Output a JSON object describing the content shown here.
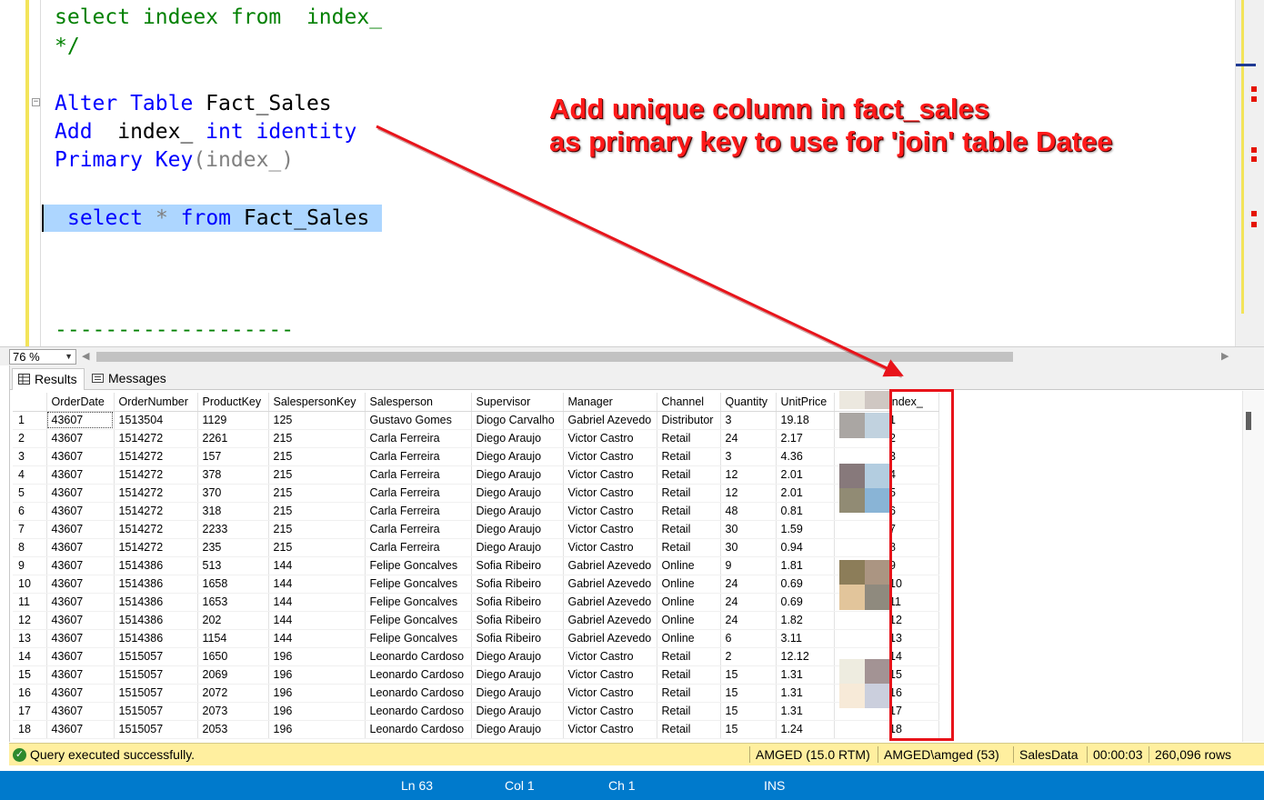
{
  "editor": {
    "line1": {
      "kw1": "select",
      "t1": " indeex ",
      "kw2": "from",
      "t2": "  index_"
    },
    "line2": "*/",
    "alter": {
      "kw": "Alter Table",
      "name": " Fact_Sales"
    },
    "add": {
      "kw": "Add",
      "mid": "  index_ ",
      "kw2": "int identity"
    },
    "pk": {
      "kw": "Primary Key",
      "rest": "(index_)"
    },
    "sel": {
      "kw": "select",
      "star": " * ",
      "kw2": "from",
      "name": " Fact_Sales "
    },
    "dashes": "-------------------"
  },
  "annotation": {
    "line1": "Add unique column in fact_sales",
    "line2": "as primary key to use for 'join' table Datee"
  },
  "zoom": {
    "value": "76 %"
  },
  "tabs": {
    "results": "Results",
    "messages": "Messages"
  },
  "grid": {
    "columns": [
      "OrderDate",
      "OrderNumber",
      "ProductKey",
      "SalespersonKey",
      "Salesperson",
      "Supervisor",
      "Manager",
      "Channel",
      "Quantity",
      "UnitPrice",
      "index_"
    ],
    "rows": [
      [
        "1",
        "43607",
        "1513504",
        "1129",
        "125",
        "Gustavo Gomes",
        "Diogo Carvalho",
        "Gabriel Azevedo",
        "Distributor",
        "3",
        "19.18",
        "1"
      ],
      [
        "2",
        "43607",
        "1514272",
        "2261",
        "215",
        "Carla Ferreira",
        "Diego Araujo",
        "Victor Castro",
        "Retail",
        "24",
        "2.17",
        "2"
      ],
      [
        "3",
        "43607",
        "1514272",
        "157",
        "215",
        "Carla Ferreira",
        "Diego Araujo",
        "Victor Castro",
        "Retail",
        "3",
        "4.36",
        "3"
      ],
      [
        "4",
        "43607",
        "1514272",
        "378",
        "215",
        "Carla Ferreira",
        "Diego Araujo",
        "Victor Castro",
        "Retail",
        "12",
        "2.01",
        "4"
      ],
      [
        "5",
        "43607",
        "1514272",
        "370",
        "215",
        "Carla Ferreira",
        "Diego Araujo",
        "Victor Castro",
        "Retail",
        "12",
        "2.01",
        "5"
      ],
      [
        "6",
        "43607",
        "1514272",
        "318",
        "215",
        "Carla Ferreira",
        "Diego Araujo",
        "Victor Castro",
        "Retail",
        "48",
        "0.81",
        "6"
      ],
      [
        "7",
        "43607",
        "1514272",
        "2233",
        "215",
        "Carla Ferreira",
        "Diego Araujo",
        "Victor Castro",
        "Retail",
        "30",
        "1.59",
        "7"
      ],
      [
        "8",
        "43607",
        "1514272",
        "235",
        "215",
        "Carla Ferreira",
        "Diego Araujo",
        "Victor Castro",
        "Retail",
        "30",
        "0.94",
        "8"
      ],
      [
        "9",
        "43607",
        "1514386",
        "513",
        "144",
        "Felipe Goncalves",
        "Sofia Ribeiro",
        "Gabriel Azevedo",
        "Online",
        "9",
        "1.81",
        "9"
      ],
      [
        "10",
        "43607",
        "1514386",
        "1658",
        "144",
        "Felipe Goncalves",
        "Sofia Ribeiro",
        "Gabriel Azevedo",
        "Online",
        "24",
        "0.69",
        "10"
      ],
      [
        "11",
        "43607",
        "1514386",
        "1653",
        "144",
        "Felipe Goncalves",
        "Sofia Ribeiro",
        "Gabriel Azevedo",
        "Online",
        "24",
        "0.69",
        "11"
      ],
      [
        "12",
        "43607",
        "1514386",
        "202",
        "144",
        "Felipe Goncalves",
        "Sofia Ribeiro",
        "Gabriel Azevedo",
        "Online",
        "24",
        "1.82",
        "12"
      ],
      [
        "13",
        "43607",
        "1514386",
        "1154",
        "144",
        "Felipe Goncalves",
        "Sofia Ribeiro",
        "Gabriel Azevedo",
        "Online",
        "6",
        "3.11",
        "13"
      ],
      [
        "14",
        "43607",
        "1515057",
        "1650",
        "196",
        "Leonardo Cardoso",
        "Diego Araujo",
        "Victor Castro",
        "Retail",
        "2",
        "12.12",
        "14"
      ],
      [
        "15",
        "43607",
        "1515057",
        "2069",
        "196",
        "Leonardo Cardoso",
        "Diego Araujo",
        "Victor Castro",
        "Retail",
        "15",
        "1.31",
        "15"
      ],
      [
        "16",
        "43607",
        "1515057",
        "2072",
        "196",
        "Leonardo Cardoso",
        "Diego Araujo",
        "Victor Castro",
        "Retail",
        "15",
        "1.31",
        "16"
      ],
      [
        "17",
        "43607",
        "1515057",
        "2073",
        "196",
        "Leonardo Cardoso",
        "Diego Araujo",
        "Victor Castro",
        "Retail",
        "15",
        "1.31",
        "17"
      ],
      [
        "18",
        "43607",
        "1515057",
        "2053",
        "196",
        "Leonardo Cardoso",
        "Diego Araujo",
        "Victor Castro",
        "Retail",
        "15",
        "1.24",
        "18"
      ]
    ]
  },
  "status": {
    "message": "Query executed successfully.",
    "server": "AMGED (15.0 RTM)",
    "user": "AMGED\\amged (53)",
    "database": "SalesData",
    "elapsed": "00:00:03",
    "rows": "260,096 rows"
  },
  "bottombar": {
    "ln": "Ln 63",
    "col": "Col 1",
    "ch": "Ch 1",
    "mode": "INS"
  },
  "colors": {
    "accent": "#007acc",
    "annotation": "#ff1a1a",
    "keyword": "#0000ff",
    "comment": "#008000",
    "statusbar": "#ffef9f"
  }
}
